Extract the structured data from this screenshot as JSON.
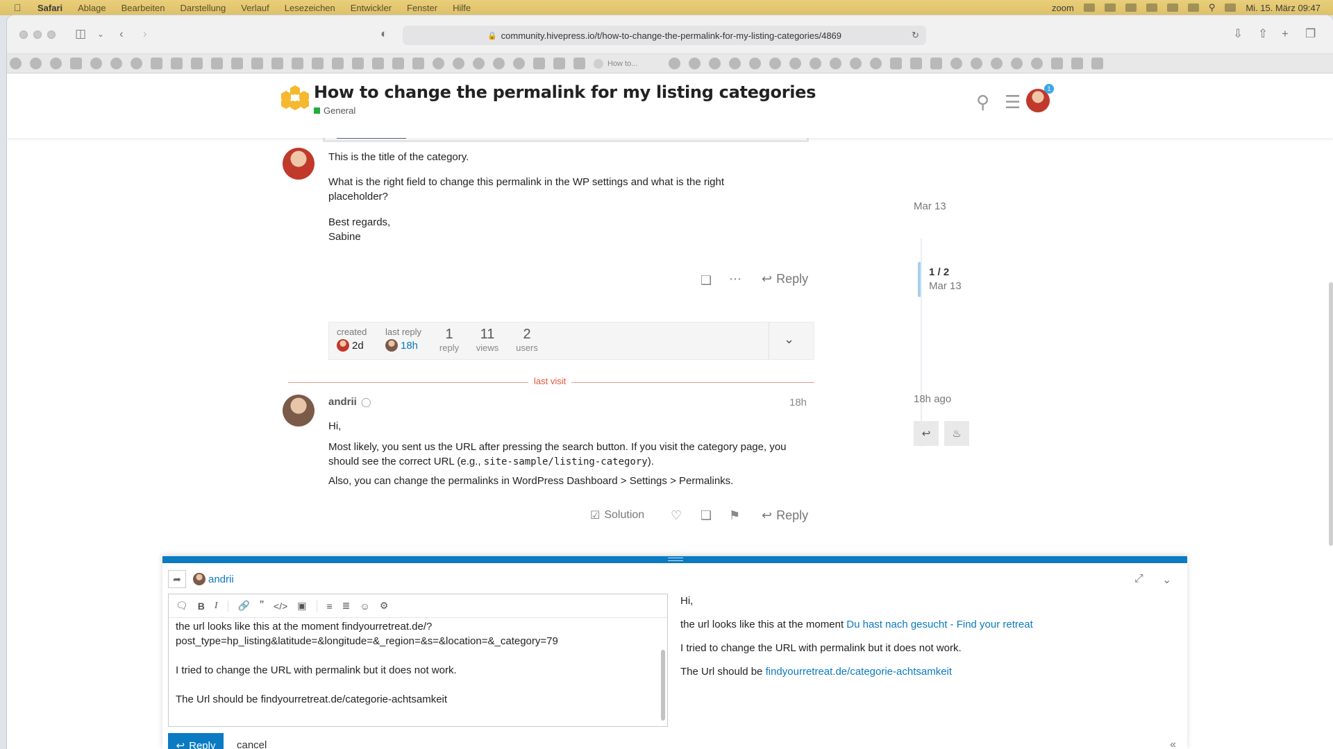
{
  "menubar": {
    "app": "Safari",
    "items": [
      "Ablage",
      "Bearbeiten",
      "Darstellung",
      "Verlauf",
      "Lesezeichen",
      "Entwickler",
      "Fenster",
      "Hilfe"
    ],
    "zoom": "zoom",
    "datetime": "Mi. 15. März  09:47"
  },
  "browser": {
    "url": "community.hivepress.io/t/how-to-change-the-permalink-for-my-listing-categories/4869",
    "tab_label": "How to..."
  },
  "header": {
    "title": "How to change the permalink for my listing categories",
    "category": "General",
    "notification_count": "1"
  },
  "post1": {
    "p1": "This is the title of the category.",
    "p2": "What is the right field to change this permalink in the WP settings and what is the right placeholder?",
    "p3a": "Best regards,",
    "p3b": "Sabine",
    "reply_label": "Reply"
  },
  "meta": {
    "created_label": "created",
    "created_val": "2d",
    "last_reply_label": "last reply",
    "last_reply_val": "18h",
    "replies_num": "1",
    "replies_lbl": "reply",
    "views_num": "11",
    "views_lbl": "views",
    "users_num": "2",
    "users_lbl": "users"
  },
  "last_visit": "last visit",
  "post2": {
    "username": "andrii",
    "time": "18h",
    "p1": "Hi,",
    "p2a": "Most likely, you sent us the URL after pressing the search button. If you visit the category page, you should see the correct URL (e.g., ",
    "p2code": "site-sample/listing-category",
    "p2b": ").",
    "p3": "Also, you can change the permalinks in WordPress Dashboard > Settings > Permalinks.",
    "solution_label": "Solution",
    "reply_label": "Reply"
  },
  "timeline": {
    "top_date": "Mar 13",
    "count": "1 / 2",
    "count_date": "Mar 13",
    "bottom_date": "18h ago"
  },
  "composer": {
    "reply_to": "andrii",
    "editor_text": "the url looks like this at the moment findyourretreat.de/?\npost_type=hp_listing&latitude=&longitude=&_region=&s=&location=&_category=79\n\nI tried to change the URL with permalink but it does not work.\n\nThe Url should be findyourretreat.de/categorie-achtsamkeit",
    "preview": {
      "p1": "Hi,",
      "p2_text": "the url looks like this at the moment ",
      "p2_link": "Du hast nach gesucht - Find your retreat",
      "p3": "I tried to change the URL with permalink but it does not work.",
      "p4_text": "The Url should be ",
      "p4_link": "findyourretreat.de/categorie-achtsamkeit"
    },
    "submit_label": "Reply",
    "cancel_label": "cancel"
  },
  "colors": {
    "accent": "#0a7ac2",
    "last_visit": "#e45735",
    "category": "#25aa40",
    "logo": "#f5b82e"
  }
}
